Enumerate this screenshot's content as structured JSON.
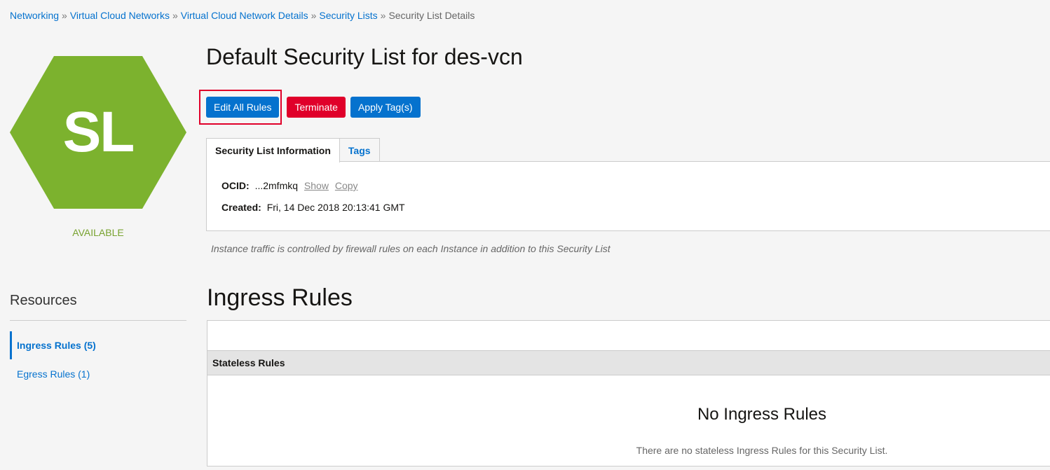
{
  "breadcrumb": {
    "items": [
      "Networking",
      "Virtual Cloud Networks",
      "Virtual Cloud Network Details",
      "Security Lists"
    ],
    "current": "Security List Details",
    "separator": "»"
  },
  "resource": {
    "icon_text": "SL",
    "icon_color": "#7cb22e",
    "state": "AVAILABLE"
  },
  "page_title": "Default Security List for des-vcn",
  "actions": {
    "edit_all_rules": "Edit All Rules",
    "terminate": "Terminate",
    "apply_tags": "Apply Tag(s)"
  },
  "tabs": {
    "info": "Security List Information",
    "tags": "Tags"
  },
  "info": {
    "ocid_label": "OCID:",
    "ocid_value": "...2mfmkq",
    "show": "Show",
    "copy": "Copy",
    "created_label": "Created:",
    "created_value": "Fri, 14 Dec 2018 20:13:41 GMT"
  },
  "note": "Instance traffic is controlled by firewall rules on each Instance in addition to this Security List",
  "resources": {
    "title": "Resources",
    "items": [
      {
        "label": "Ingress Rules (5)",
        "active": true
      },
      {
        "label": "Egress Rules (1)",
        "active": false
      }
    ]
  },
  "ingress": {
    "title": "Ingress Rules",
    "table_header": "Stateless Rules",
    "empty_title": "No Ingress Rules",
    "empty_desc": "There are no stateless Ingress Rules for this Security List."
  },
  "colors": {
    "accent": "#0572ce",
    "danger": "#e0002a",
    "available": "#78a22f"
  }
}
